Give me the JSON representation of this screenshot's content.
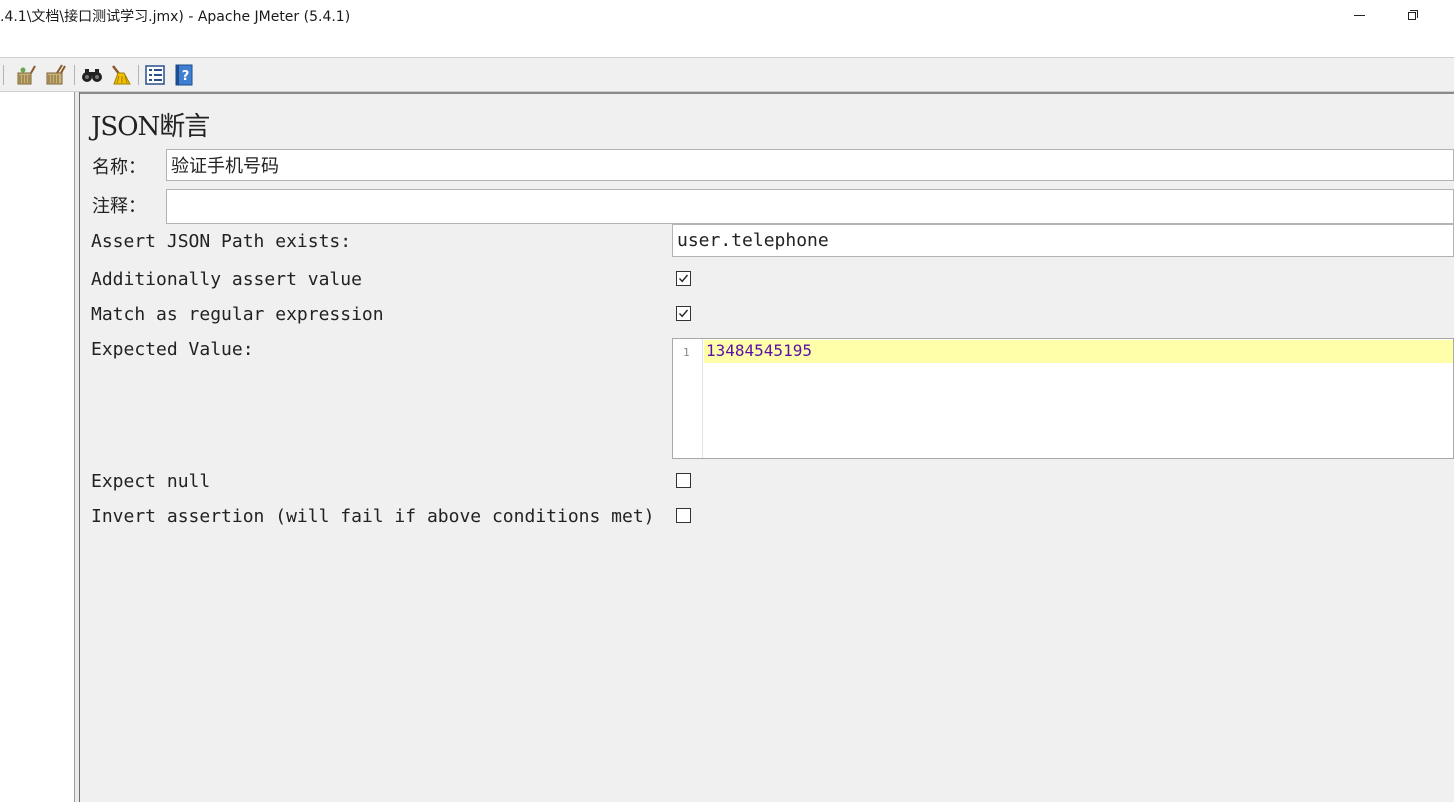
{
  "window": {
    "title": ".4.1\\文档\\接口测试学习.jmx) - Apache JMeter (5.4.1)"
  },
  "toolbar": {
    "icons": [
      "broom-icon",
      "broom-all-icon",
      "binoculars-icon",
      "clear-search-icon",
      "function-helper-icon",
      "help-icon"
    ]
  },
  "panel": {
    "title": "JSON断言",
    "name_label": "名称：",
    "name_value": "验证手机号码",
    "comment_label": "注释：",
    "comment_value": "",
    "json_path_label": "Assert JSON Path exists:",
    "json_path_value": "user.telephone",
    "additionally_assert_label": "Additionally assert value",
    "additionally_assert_checked": true,
    "match_regex_label": "Match as regular expression",
    "match_regex_checked": true,
    "expected_value_label": "Expected Value:",
    "expected_value": {
      "line_number": "1",
      "text": "13484545195"
    },
    "expect_null_label": "Expect null",
    "expect_null_checked": false,
    "invert_label": "Invert assertion (will fail if above conditions met)",
    "invert_checked": false
  },
  "colors": {
    "panel_background": "#f0f0f0",
    "editor_line_highlight": "#ffffaa",
    "editor_text": "#5a0fa8"
  }
}
